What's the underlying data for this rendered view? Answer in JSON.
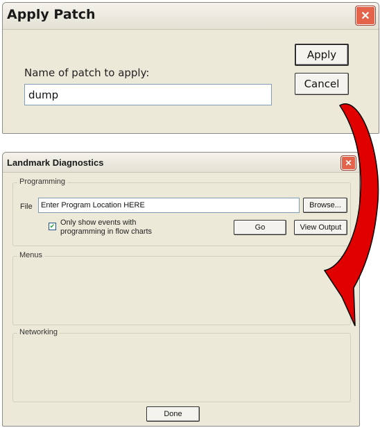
{
  "apply_patch": {
    "title": "Apply Patch",
    "close_glyph": "✕",
    "label": "Name of patch to apply:",
    "input_value": "dump",
    "apply_label": "Apply",
    "cancel_label": "Cancel"
  },
  "diagnostics": {
    "title": "Landmark Diagnostics",
    "close_glyph": "✕",
    "programming": {
      "group_label": "Programming",
      "file_label": "File",
      "file_value": "Enter Program Location HERE",
      "browse_label": "Browse...",
      "checkbox_mark": "✔",
      "checkbox_line1": "Only show events with",
      "checkbox_line2": "programming in flow charts",
      "checkbox_checked": true,
      "go_label": "Go",
      "view_output_label": "View Output"
    },
    "menus": {
      "group_label": "Menus"
    },
    "networking": {
      "group_label": "Networking"
    },
    "done_label": "Done"
  },
  "arrow": {
    "color": "#e00000"
  },
  "icons": [
    "close-icon",
    "checkbox-check-icon",
    "curved-arrow-icon"
  ]
}
